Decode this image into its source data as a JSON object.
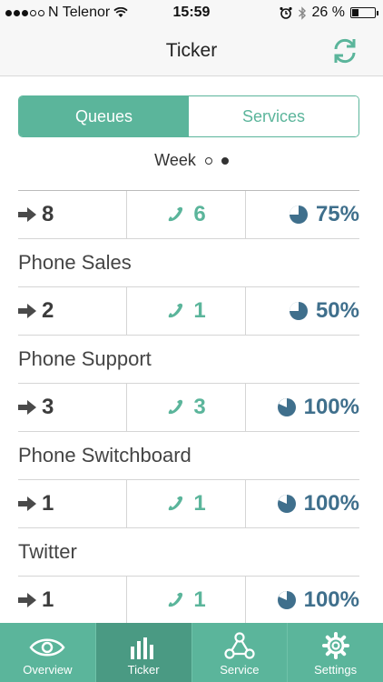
{
  "status_bar": {
    "carrier": "N Telenor",
    "time": "15:59",
    "battery": "26 %"
  },
  "nav": {
    "title": "Ticker"
  },
  "segmented": {
    "queues": "Queues",
    "services": "Services"
  },
  "period": {
    "label": "Week"
  },
  "rows": [
    {
      "name": "",
      "waiting": "8",
      "answered": "6",
      "percent": "75%"
    },
    {
      "name": "Phone Sales",
      "waiting": "2",
      "answered": "1",
      "percent": "50%"
    },
    {
      "name": "Phone Support",
      "waiting": "3",
      "answered": "3",
      "percent": "100%"
    },
    {
      "name": "Phone Switchboard",
      "waiting": "1",
      "answered": "1",
      "percent": "100%"
    },
    {
      "name": "Twitter",
      "waiting": "1",
      "answered": "1",
      "percent": "100%"
    }
  ],
  "tabs": {
    "overview": "Overview",
    "ticker": "Ticker",
    "service": "Service",
    "settings": "Settings"
  },
  "colors": {
    "accent": "#5bb59b",
    "accent_dark": "#4a9a83",
    "percent_blue": "#3f6f8c"
  }
}
